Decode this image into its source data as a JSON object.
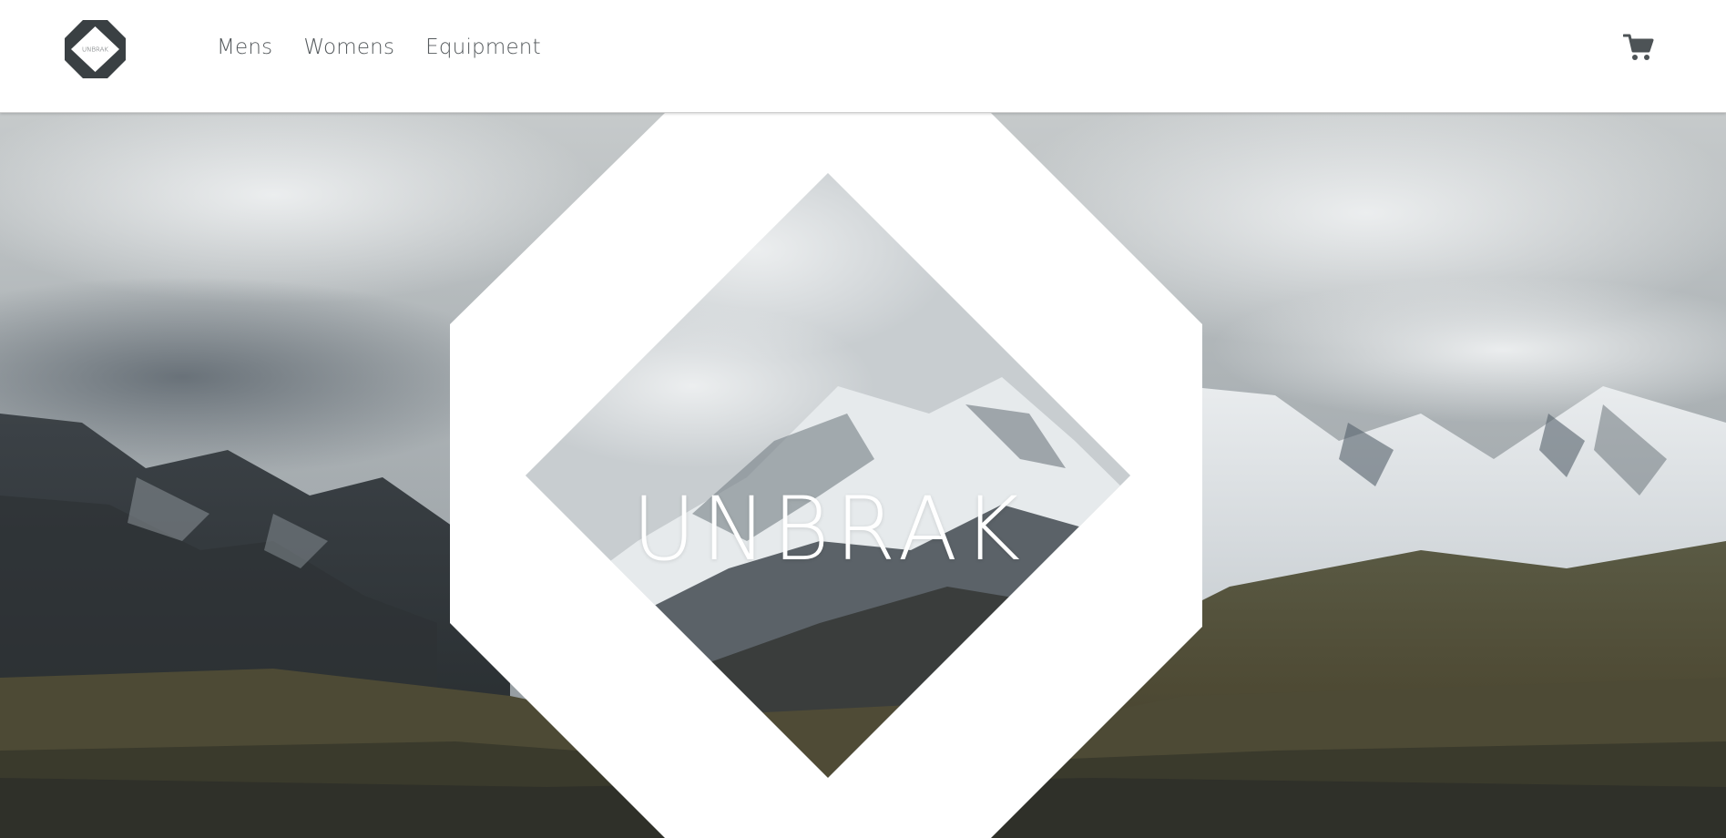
{
  "header": {
    "logo": {
      "text": "UNBRAK",
      "icon": "octagon-logo-icon",
      "color": "#3a4043"
    },
    "nav": [
      {
        "label": "Mens"
      },
      {
        "label": "Womens"
      },
      {
        "label": "Equipment"
      }
    ],
    "cart": {
      "icon": "shopping-cart-icon",
      "color": "#4d5356"
    }
  },
  "hero": {
    "title": "UNBRAK",
    "background": "snowy-mountain-landscape-image",
    "frame_color": "#ffffff"
  }
}
